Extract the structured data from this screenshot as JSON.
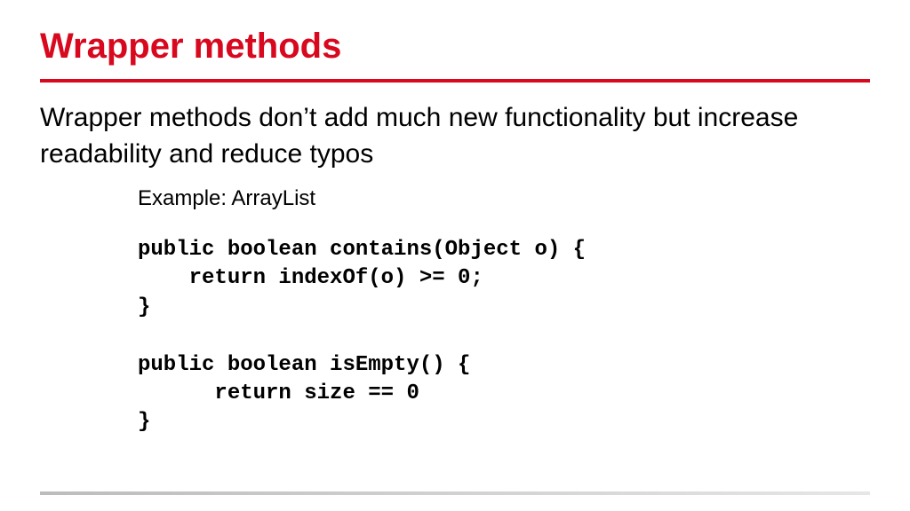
{
  "title": "Wrapper methods",
  "body_text": "Wrapper methods don’t add much new functionality but increase readability and reduce typos",
  "example_label": "Example: ArrayList",
  "code": "public boolean contains(Object o) {\n    return indexOf(o) >= 0;\n}\n\npublic boolean isEmpty() {\n      return size == 0\n}"
}
